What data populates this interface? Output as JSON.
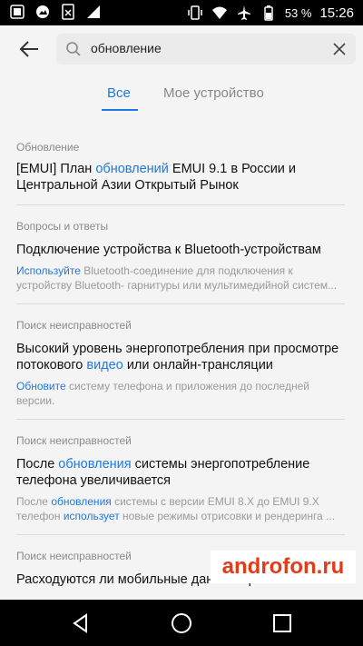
{
  "status_bar": {
    "battery": "53 %",
    "time": "15:26",
    "icons": [
      "notification-icon",
      "image-icon",
      "sim-icon",
      "network-off-icon",
      "vibrate-icon",
      "wifi-icon",
      "airplane-icon",
      "battery-icon"
    ]
  },
  "header": {
    "back_icon": "back-arrow-icon",
    "search_value": "обновление",
    "clear_icon": "close-icon"
  },
  "tabs": {
    "all": "Все",
    "my_device": "Мое устройство"
  },
  "results": [
    {
      "category": "Обновление",
      "title_before": "[EMUI] План ",
      "title_hl": "обновлений",
      "title_after": " EMUI 9.1 в России и Центральной Азии Открытый Рынок"
    },
    {
      "category": "Вопросы и ответы",
      "title": "Подключение устройства к Bluetooth-устройствам",
      "desc_hl": "Используйте",
      "desc_rest": " Bluetooth-соединение для подключения к устройству Bluetooth- гарнитуры или мультимедийной систем..."
    },
    {
      "category": "Поиск неисправностей",
      "title_before": "Высокий уровень энергопотребления при просмотре потокового ",
      "title_hl": "видео",
      "title_after": " или онлайн-трансляции",
      "desc_hl": "Обновите",
      "desc_rest": " систему телефона и приложения до последней версии."
    },
    {
      "category": "Поиск неисправностей",
      "title_before": "После ",
      "title_hl": "обновления",
      "title_after": " системы энергопотребление телефона увеличивается",
      "desc_before": "После ",
      "desc_hl1": "обновления",
      "desc_mid": " системы с версии EMUI 8.X до EMUI 9.X телефон ",
      "desc_hl2": "использует",
      "desc_after": " новые режимы отрисовки и рендеринга ..."
    },
    {
      "category": "Поиск неисправностей",
      "title": "Расходуются ли мобильные данные при вызовах"
    }
  ],
  "watermark": "androfon.ru",
  "nav_bar": {
    "back_icon": "nav-back-icon",
    "home_icon": "nav-home-icon",
    "recents_icon": "nav-recents-icon"
  },
  "colors": {
    "accent": "#1e7ae0",
    "watermark": "#e23b1a"
  }
}
